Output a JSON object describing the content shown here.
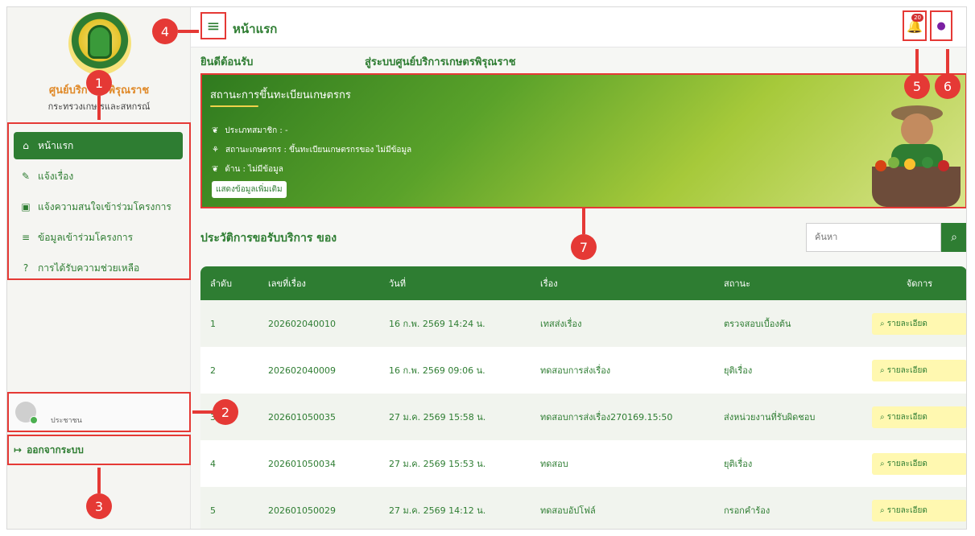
{
  "sidebar": {
    "org_name": "ศูนย์บริการ        รพิรุณราช",
    "org_sub": "กระทรวงเกษ  รและสหกรณ์",
    "items": [
      {
        "icon": "home-icon",
        "label": "หน้าแรก"
      },
      {
        "icon": "edit-icon",
        "label": "แจ้งเรื่อง"
      },
      {
        "icon": "clipboard-icon",
        "label": "แจ้งความสนใจเข้าร่วมโครงการ"
      },
      {
        "icon": "list-icon",
        "label": "ข้อมูลเข้าร่วมโครงการ"
      },
      {
        "icon": "help-icon",
        "label": "การได้รับความช่วยเหลือ"
      }
    ],
    "user_role": "ประชาชน",
    "logout_label": "ออกจากระบบ"
  },
  "topbar": {
    "title": "หน้าแรก",
    "badge_count": "20"
  },
  "welcome": {
    "left": "ยินดีต้อนรับ",
    "right": "สู่ระบบศูนย์บริการเกษตรพิรุณราช"
  },
  "banner": {
    "title": "สถานะการขึ้นทะเบียนเกษตรกร",
    "member_type": "ประเภทสมาชิก : -",
    "farmer_status": "สถานะเกษตรกร : ขึ้นทะเบียนเกษตรกรของ ไม่มีข้อมูล",
    "side": "ด้าน : ไม่มีข้อมูล",
    "button": "แสดงข้อมูลเพิ่มเติม"
  },
  "history": {
    "title": "ประวัติการขอรับบริการ ของ",
    "search_placeholder": "ค้นหา"
  },
  "table": {
    "headers": [
      "ลำดับ",
      "เลขที่เรื่อง",
      "วันที่",
      "เรื่อง",
      "สถานะ",
      "จัดการ"
    ],
    "rows": [
      [
        "1",
        "202602040010",
        "16 ก.พ. 2569 14:24 น.",
        "เทสส่งเรื่อง",
        "ตรวจสอบเบื้องต้น",
        "รายละเอียด"
      ],
      [
        "2",
        "202602040009",
        "16 ก.พ. 2569 09:06 น.",
        "ทดสอบการส่งเรื่อง",
        "ยุติเรื่อง",
        "รายละเอียด"
      ],
      [
        "3",
        "202601050035",
        "27 ม.ค. 2569 15:58 น.",
        "ทดสอบการส่งเรื่อง270169.15:50",
        "ส่งหน่วยงานที่รับผิดชอบ",
        "รายละเอียด"
      ],
      [
        "4",
        "202601050034",
        "27 ม.ค. 2569 15:53 น.",
        "ทดสอบ",
        "ยุติเรื่อง",
        "รายละเอียด"
      ],
      [
        "5",
        "202601050029",
        "27 ม.ค. 2569 14:12 น.",
        "ทดสอบอัปโฟล์",
        "กรอกคำร้อง",
        "รายละเอียด"
      ]
    ]
  },
  "callouts": [
    "1",
    "2",
    "3",
    "4",
    "5",
    "6",
    "7"
  ],
  "colors": {
    "brand": "#2e7d32",
    "callout": "#e53935",
    "detail_button": "#fff8b0"
  }
}
